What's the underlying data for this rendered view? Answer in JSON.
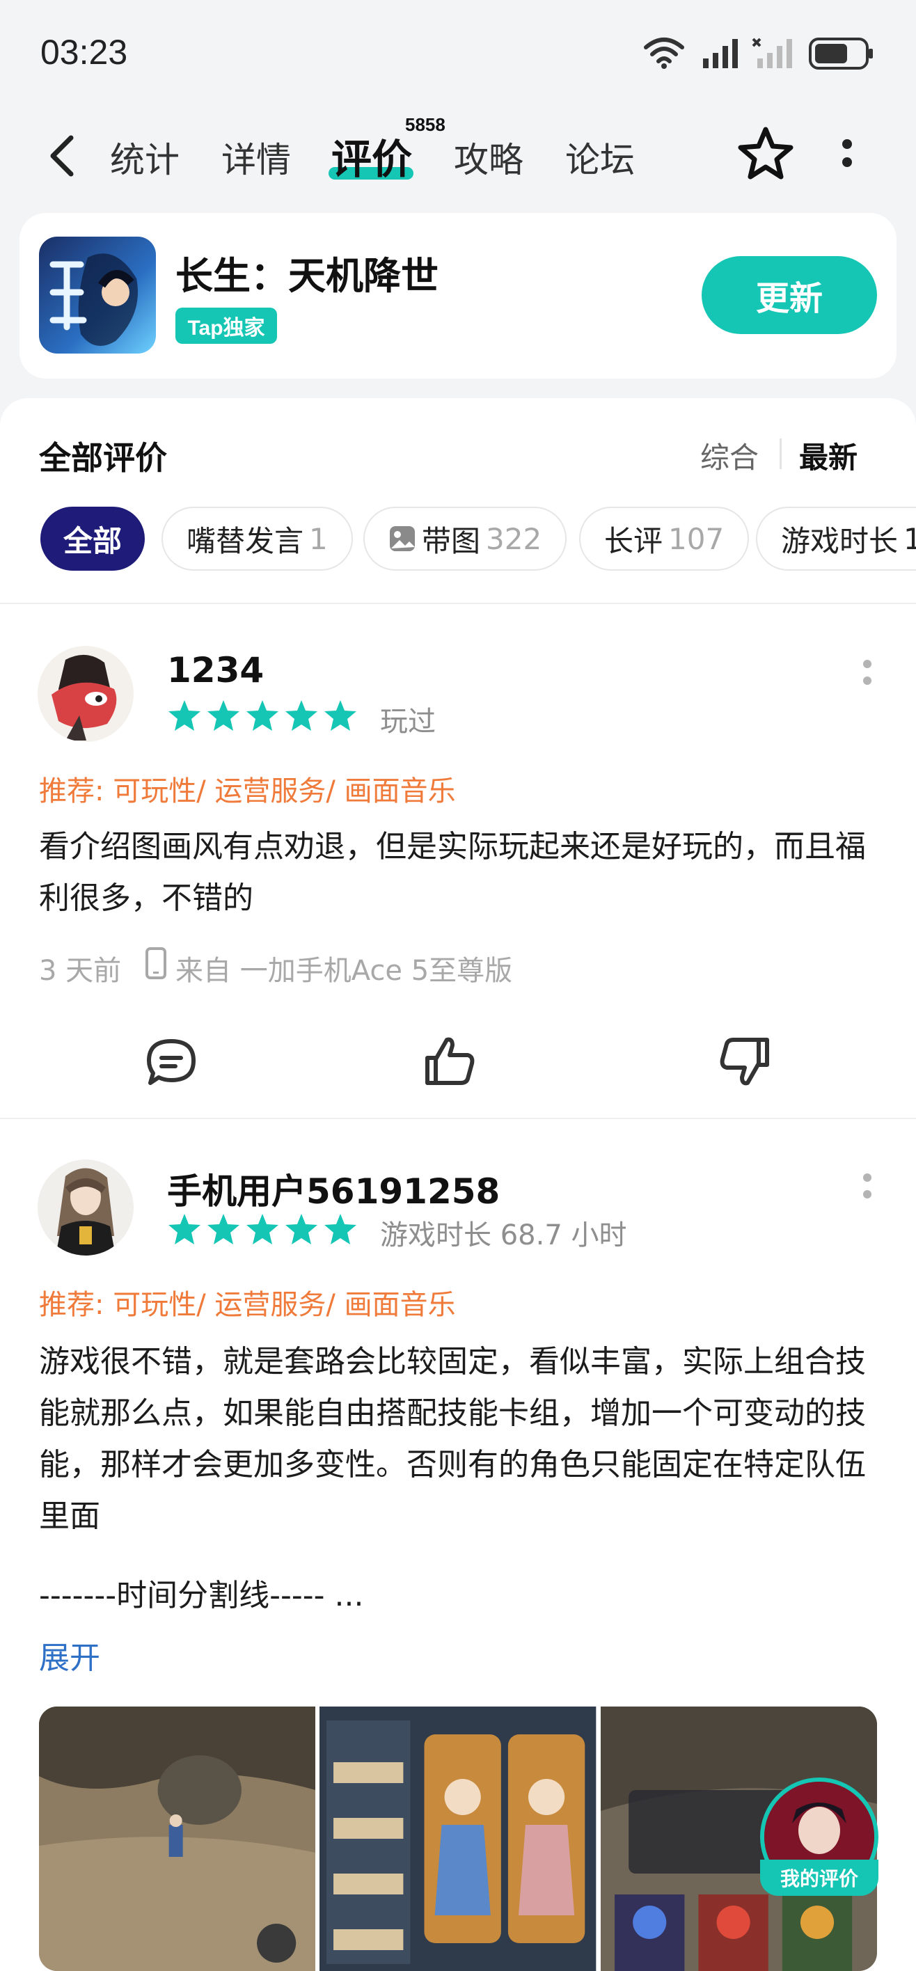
{
  "status_bar": {
    "time": "03:23"
  },
  "nav": {
    "tabs": [
      {
        "label": "统计"
      },
      {
        "label": "详情"
      },
      {
        "label": "评价",
        "badge": "5858"
      },
      {
        "label": "攻略"
      },
      {
        "label": "论坛"
      }
    ],
    "active_tab": "评价"
  },
  "game": {
    "title": "长生：天机降世",
    "badge": "Tap独家",
    "action": "更新"
  },
  "reviews_section": {
    "title": "全部评价",
    "sort_options": [
      "综合",
      "最新"
    ],
    "active_sort": "最新",
    "filters": [
      {
        "label": "全部",
        "count": ""
      },
      {
        "label": "嘴替发言",
        "count": "1"
      },
      {
        "label": "带图",
        "count": "322"
      },
      {
        "label": "长评",
        "count": "107"
      },
      {
        "label": "游戏时长",
        "count": "1"
      }
    ]
  },
  "reviews": [
    {
      "username": "1234",
      "rating": 5,
      "play_status": "玩过",
      "recommend": "推荐: 可玩性/ 运营服务/ 画面音乐",
      "text": "看介绍图画风有点劝退，但是实际玩起来还是好玩的，而且福利很多，不错的",
      "time": "3 天前",
      "device": "来自 一加手机Ace 5至尊版"
    },
    {
      "username": "手机用户56191258",
      "rating": 5,
      "play_status": "游戏时长 68.7 小时",
      "recommend": "推荐: 可玩性/ 运营服务/ 画面音乐",
      "text": "游戏很不错，就是套路会比较固定，看似丰富，实际上组合技能就那么点，如果能自由搭配技能卡组，增加一个可变动的技能，那样才会更加多变性。否则有的角色只能固定在特定队伍里面",
      "divider_line": "-------时间分割线----- ...",
      "expand_label": "展开"
    }
  ],
  "floating": {
    "my_review_label": "我的评价"
  },
  "colors": {
    "accent": "#15c6b4",
    "active_chip": "#1f1b78",
    "recommend": "#ef7a3a",
    "link": "#2f70c7"
  }
}
